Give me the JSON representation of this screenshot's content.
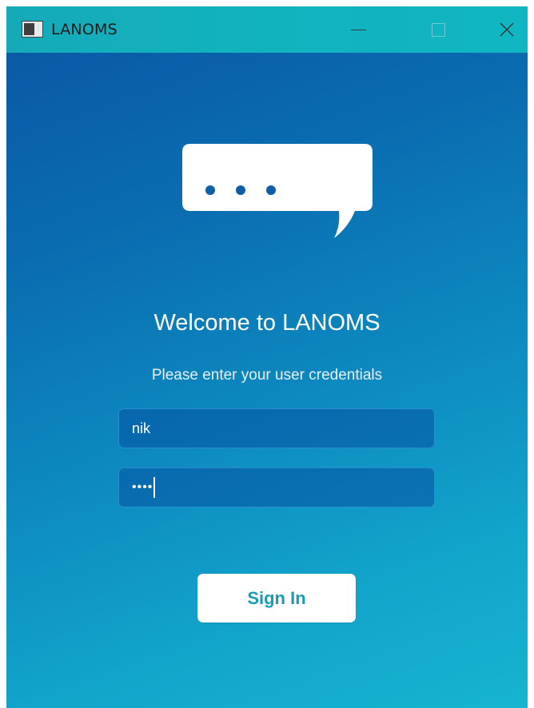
{
  "window": {
    "title": "LANOMS",
    "icon": "app-window-icon",
    "controls": {
      "minimize_icon": "minimize-icon",
      "maximize_icon": "maximize-icon",
      "close_icon": "close-icon",
      "close_glyph": "✕"
    }
  },
  "login": {
    "logo_icon": "chat-bubble-icon",
    "welcome": "Welcome to LANOMS",
    "subtitle": "Please enter your user credentials",
    "username_value": "nik",
    "password_masked": "••••",
    "signin_label": "Sign In"
  },
  "colors": {
    "titlebar": "#11b3bf",
    "gradient_start": "#0a5aa6",
    "gradient_end": "#16b4d0",
    "button_text": "#1a9bb4",
    "field_bg": "#0550a0"
  }
}
